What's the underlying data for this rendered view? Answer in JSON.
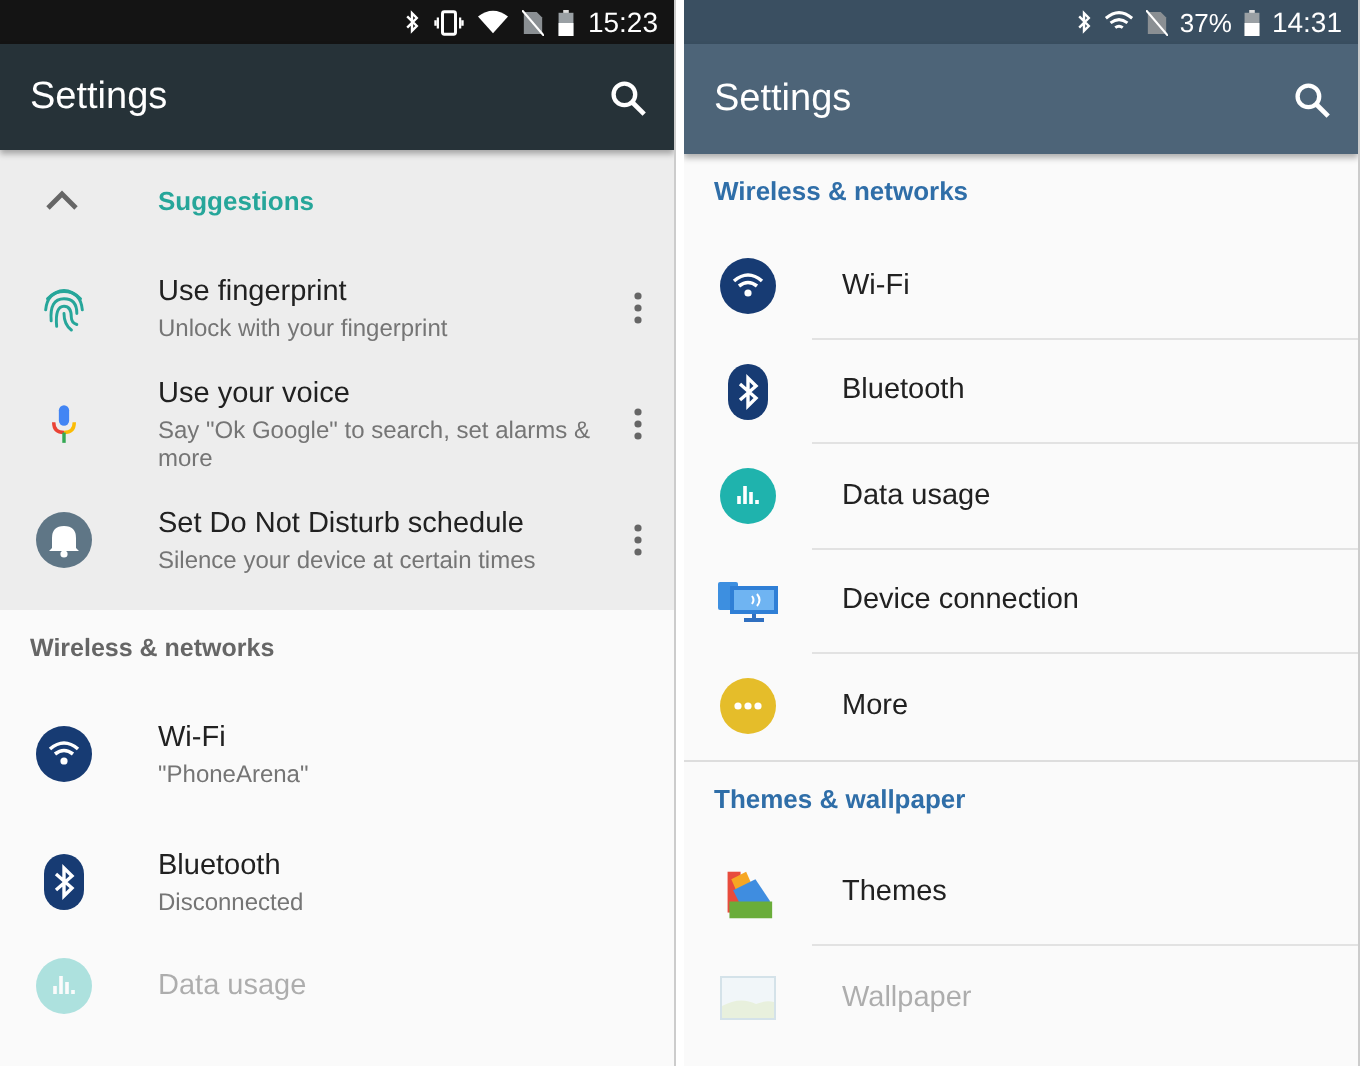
{
  "phones": [
    {
      "kind": "stock",
      "status_bar": {
        "time": "15:23"
      },
      "app_bar": {
        "title": "Settings"
      },
      "sections": [
        {
          "kind": "suggestions",
          "title": "Suggestions",
          "expanded": true,
          "items": [
            {
              "kind": "fingerprint",
              "title": "Use fingerprint",
              "subtitle": "Unlock with your fingerprint"
            },
            {
              "kind": "mic",
              "title": "Use your voice",
              "subtitle": "Say \"Ok Google\" to search, set alarms & more"
            },
            {
              "kind": "bell",
              "title": "Set Do Not Disturb schedule",
              "subtitle": "Silence your device at certain times"
            }
          ]
        },
        {
          "kind": "category",
          "title": "Wireless & networks",
          "items": [
            {
              "kind": "wifi",
              "title": "Wi-Fi",
              "subtitle": "\"PhoneArena\"",
              "faded": false
            },
            {
              "kind": "bluetooth",
              "title": "Bluetooth",
              "subtitle": "Disconnected",
              "faded": false
            },
            {
              "kind": "data",
              "title": "Data usage",
              "faded": true
            }
          ]
        }
      ]
    },
    {
      "kind": "skinned",
      "status_bar": {
        "battery_percent": "37%",
        "time": "14:31"
      },
      "app_bar": {
        "title": "Settings"
      },
      "sections": [
        {
          "kind": "category",
          "title": "Wireless & networks",
          "items": [
            {
              "kind": "wifi",
              "title": "Wi-Fi",
              "faded": false
            },
            {
              "kind": "bluetooth",
              "title": "Bluetooth",
              "faded": false
            },
            {
              "kind": "data",
              "title": "Data usage",
              "faded": false
            },
            {
              "kind": "device",
              "title": "Device connection",
              "faded": false
            },
            {
              "kind": "more",
              "title": "More",
              "faded": false
            }
          ]
        },
        {
          "kind": "category",
          "title": "Themes & wallpaper",
          "items": [
            {
              "kind": "themes",
              "title": "Themes",
              "faded": false
            },
            {
              "kind": "wallpaper",
              "title": "Wallpaper",
              "faded": true
            }
          ]
        }
      ]
    }
  ]
}
